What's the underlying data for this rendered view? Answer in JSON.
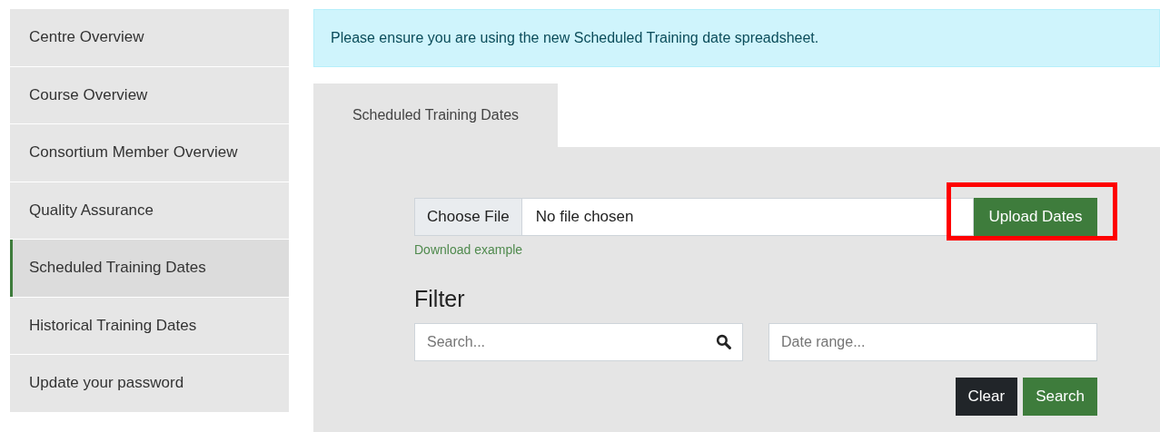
{
  "sidebar": {
    "items": [
      {
        "label": "Centre Overview",
        "selected": false
      },
      {
        "label": "Course Overview",
        "selected": false
      },
      {
        "label": "Consortium Member Overview",
        "selected": false
      },
      {
        "label": "Quality Assurance",
        "selected": false
      },
      {
        "label": "Scheduled Training Dates",
        "selected": true
      },
      {
        "label": "Historical Training Dates",
        "selected": false
      },
      {
        "label": "Update your password",
        "selected": false
      }
    ]
  },
  "alert": {
    "text": "Please ensure you are using the new Scheduled Training date spreadsheet."
  },
  "tabs": [
    {
      "label": "Scheduled Training Dates",
      "selected": true
    }
  ],
  "upload": {
    "choose_label": "Choose File",
    "file_status": "No file chosen",
    "button": "Upload Dates",
    "highlighted": true,
    "example_link": "Download example"
  },
  "filter": {
    "title": "Filter",
    "search": {
      "placeholder": "Search..."
    },
    "date_range": {
      "placeholder": "Date range..."
    },
    "buttons": [
      {
        "label": "Clear",
        "kind": "secondary"
      },
      {
        "label": "Search",
        "kind": "primary"
      }
    ]
  }
}
